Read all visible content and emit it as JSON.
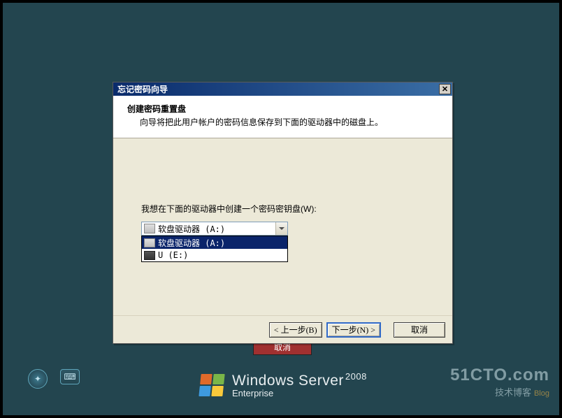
{
  "wizard": {
    "title": "忘记密码向导",
    "header_title": "创建密码重置盘",
    "header_sub": "向导将把此用户帐户的密码信息保存到下面的驱动器中的磁盘上。",
    "prompt": "我想在下面的驱动器中创建一个密码密钥盘(W):",
    "combo_selected": "软盘驱动器 (A:)",
    "options": [
      {
        "label": "软盘驱动器 (A:)",
        "selected": true,
        "kind": "floppy"
      },
      {
        "label": "U (E:)",
        "selected": false,
        "kind": "usb"
      }
    ],
    "buttons": {
      "back": "< 上一步(B)",
      "next": "下一步(N) >",
      "cancel": "取消"
    }
  },
  "background_cancel": "取消",
  "brand": {
    "name": "Windows Server",
    "year": "2008",
    "edition": "Enterprise"
  },
  "watermark": {
    "line1": "51CTO.com",
    "line2": "技术博客",
    "tag": "Blog"
  }
}
